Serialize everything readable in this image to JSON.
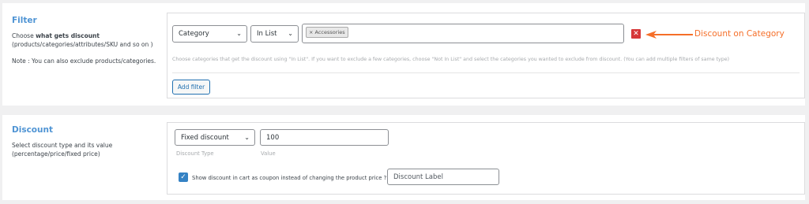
{
  "filter_section": {
    "title": "Filter",
    "desc_prefix": "Choose ",
    "desc_bold": "what gets discount",
    "desc_line2": "(products/categories/attributes/SKU and so on )",
    "note": "Note : You can also exclude products/categories.",
    "type_select": "Category",
    "operator_select": "In List",
    "selected_tag": "× Accessories",
    "help_text": "Choose categories that get the discount using \"In List\". If you want to exclude a few categories, choose \"Not In List\" and select the categories you wanted to exclude from discount. (You can add multiple filters of same type)",
    "add_filter_label": "Add filter",
    "remove_label": "✕",
    "annotation": "Discount on Category"
  },
  "discount_section": {
    "title": "Discount",
    "desc_line1": "Select discount type and its value",
    "desc_line2": "(percentage/price/fixed price)",
    "type_select": "Fixed discount",
    "type_label": "Discount Type",
    "value": "100",
    "value_label": "Value",
    "coupon_checkbox_label": "Show discount in cart as coupon instead of changing the product price ?",
    "coupon_checked": true,
    "discount_label_placeholder": "Discount Label"
  },
  "colors": {
    "accent": "#4f94d4",
    "annotation": "#f56e28",
    "remove": "#d63638",
    "checkbox": "#3582c4"
  },
  "icons": {
    "chevron": "chevron-down-icon",
    "remove": "close-icon",
    "arrow": "arrow-left-icon",
    "check": "check-icon"
  }
}
